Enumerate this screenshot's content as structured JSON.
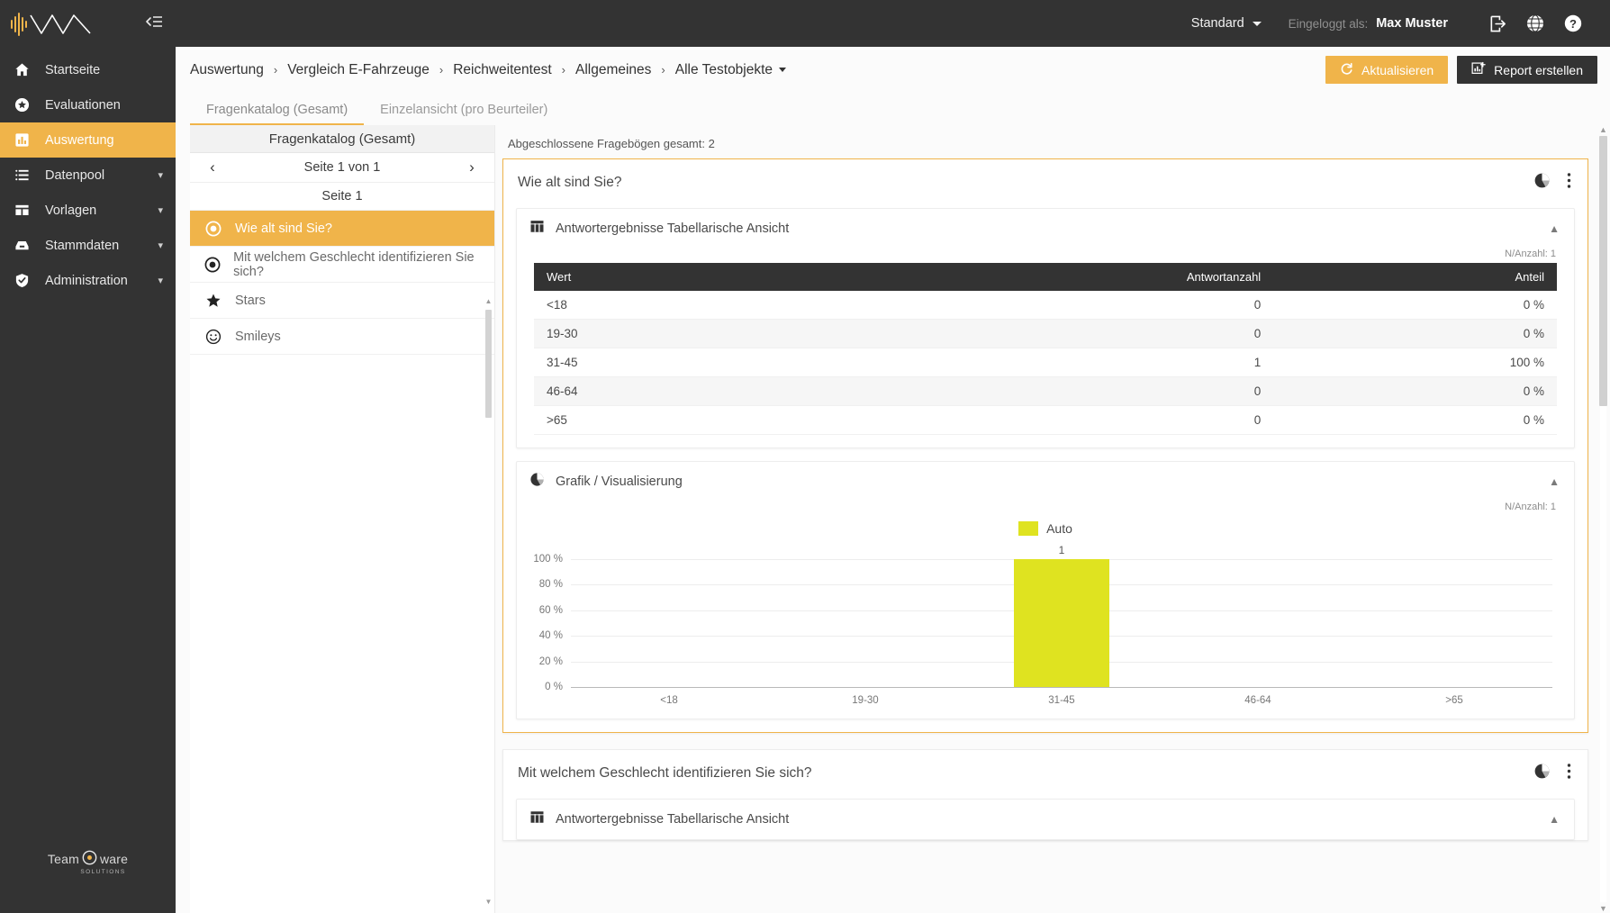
{
  "topbar": {
    "mode_select": "Standard",
    "logged_in_label": "Eingeloggt als:",
    "user_name": "Max Muster",
    "icons": [
      "logout-icon",
      "globe-icon",
      "help-icon"
    ]
  },
  "sidebar": {
    "logo_name": "waveform-logo",
    "collapse_icon": "collapse-sidebar-icon",
    "items": [
      {
        "label": "Startseite",
        "icon": "home-icon",
        "active": false,
        "expandable": false
      },
      {
        "label": "Evaluationen",
        "icon": "star-circle-icon",
        "active": false,
        "expandable": false
      },
      {
        "label": "Auswertung",
        "icon": "bar-chart-icon",
        "active": true,
        "expandable": false
      },
      {
        "label": "Datenpool",
        "icon": "list-icon",
        "active": false,
        "expandable": true
      },
      {
        "label": "Vorlagen",
        "icon": "layout-icon",
        "active": false,
        "expandable": true
      },
      {
        "label": "Stammdaten",
        "icon": "archive-icon",
        "active": false,
        "expandable": true
      },
      {
        "label": "Administration",
        "icon": "shield-check-icon",
        "active": false,
        "expandable": true
      }
    ],
    "brand": {
      "name_a": "Team",
      "name_b": "ware",
      "subtitle": "SOLUTIONS"
    }
  },
  "breadcrumb": {
    "items": [
      "Auswertung",
      "Vergleich E-Fahrzeuge",
      "Reichweitentest",
      "Allgemeines"
    ],
    "last": "Alle Testobjekte",
    "separator": "›"
  },
  "actions": {
    "refresh_label": "Aktualisieren",
    "refresh_icon": "refresh-icon",
    "report_label": "Report erstellen",
    "report_icon": "chart-add-icon"
  },
  "tabs": [
    {
      "label": "Fragenkatalog (Gesamt)",
      "active": true
    },
    {
      "label": "Einzelansicht (pro Beurteiler)",
      "active": false
    }
  ],
  "question_panel": {
    "header": "Fragenkatalog (Gesamt)",
    "pager": {
      "prev_icon": "chevron-left-icon",
      "text": "Seite 1 von 1",
      "next_icon": "chevron-right-icon"
    },
    "page_label": "Seite 1",
    "items": [
      {
        "label": "Wie alt sind Sie?",
        "icon": "radio-button-icon",
        "active": true
      },
      {
        "label": "Mit welchem Geschlecht identifizieren Sie sich?",
        "icon": "radio-button-icon",
        "active": false
      },
      {
        "label": "Stars",
        "icon": "star-icon",
        "active": false
      },
      {
        "label": "Smileys",
        "icon": "smiley-icon",
        "active": false
      }
    ]
  },
  "results": {
    "total_line": "Abgeschlossene Fragebögen gesamt: 2",
    "cards": [
      {
        "title": "Wie alt sind Sie?",
        "chart_icon": "pie-chart-icon",
        "menu_icon": "more-vertical-icon",
        "table_section": {
          "icon": "table-icon",
          "title": "Antwortergebnisse Tabellarische Ansicht",
          "collapse_icon": "chevron-up-icon",
          "n_label": "N/Anzahl: 1",
          "columns": [
            "Wert",
            "Antwortanzahl",
            "Anteil"
          ],
          "rows": [
            {
              "wert": "<18",
              "antwortanzahl": "0",
              "anteil": "0 %"
            },
            {
              "wert": "19-30",
              "antwortanzahl": "0",
              "anteil": "0 %"
            },
            {
              "wert": "31-45",
              "antwortanzahl": "1",
              "anteil": "100 %"
            },
            {
              "wert": "46-64",
              "antwortanzahl": "0",
              "anteil": "0 %"
            },
            {
              "wert": ">65",
              "antwortanzahl": "0",
              "anteil": "0 %"
            }
          ]
        },
        "chart_section": {
          "icon": "pie-chart-icon",
          "title": "Grafik / Visualisierung",
          "collapse_icon": "chevron-up-icon",
          "n_label": "N/Anzahl: 1"
        }
      },
      {
        "title": "Mit welchem Geschlecht identifizieren Sie sich?",
        "chart_icon": "pie-chart-icon",
        "menu_icon": "more-vertical-icon",
        "table_section": {
          "icon": "table-icon",
          "title": "Antwortergebnisse Tabellarische Ansicht",
          "collapse_icon": "chevron-up-icon"
        }
      }
    ]
  },
  "chart_data": {
    "type": "bar",
    "title": "Grafik / Visualisierung",
    "categories": [
      "<18",
      "19-30",
      "31-45",
      "46-64",
      ">65"
    ],
    "series": [
      {
        "name": "Auto",
        "color": "#dfe320",
        "values": [
          0,
          0,
          100,
          0,
          0
        ],
        "point_labels": [
          "",
          "",
          "1",
          "",
          ""
        ]
      }
    ],
    "ylabel": "",
    "xlabel": "",
    "ylim": [
      0,
      100
    ],
    "ytick_labels": [
      "0 %",
      "20 %",
      "40 %",
      "60 %",
      "80 %",
      "100 %"
    ],
    "ytick_values": [
      0,
      20,
      40,
      60,
      80,
      100
    ],
    "grid": true,
    "legend_position": "top-center"
  },
  "colors": {
    "accent": "#f0b44a",
    "dark": "#333333",
    "bar": "#dfe320"
  }
}
